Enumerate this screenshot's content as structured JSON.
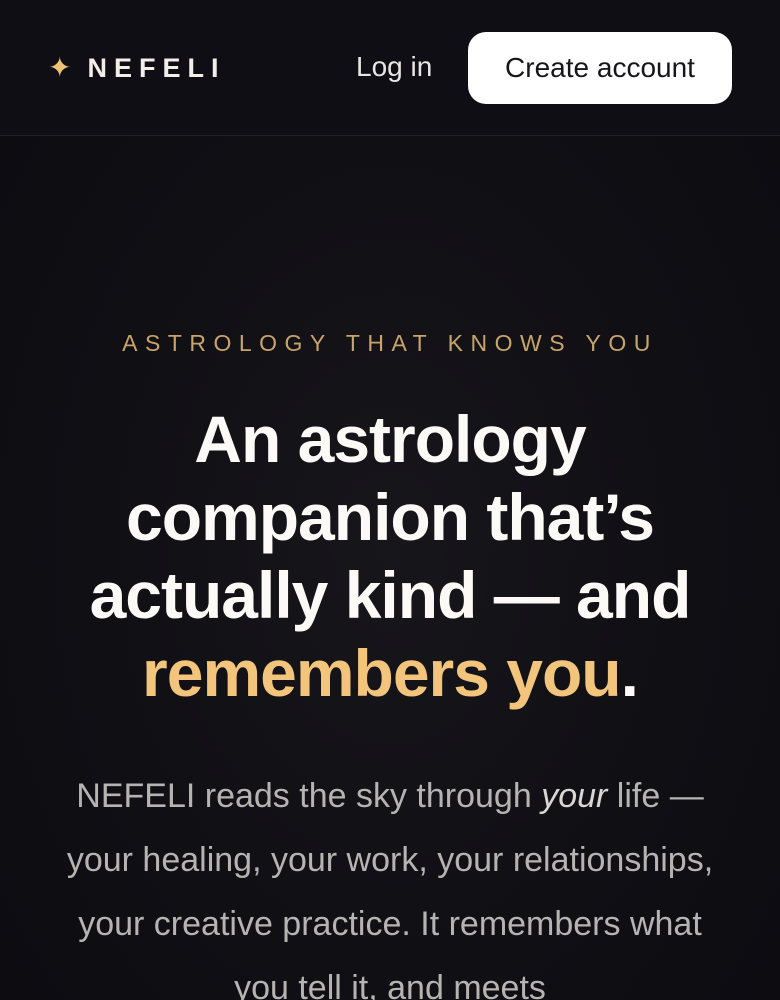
{
  "header": {
    "brand_icon": "four-pointed-star-icon",
    "brand_name": "NEFELI",
    "login_label": "Log in",
    "create_account_label": "Create account"
  },
  "hero": {
    "eyebrow": "ASTROLOGY THAT KNOWS YOU",
    "headline_main": "An astrology companion that’s actually kind — and",
    "headline_accent": "remembers you",
    "headline_end": ".",
    "subtext_part1": "NEFELI reads the sky through",
    "subtext_emphasis": "your",
    "subtext_part2": "life — your healing, your work, your relationships, your creative practice. It remembers what you tell it, and meets"
  },
  "colors": {
    "accent": "#f3c47c",
    "eyebrow": "#c9a46a",
    "background": "#0d0d12",
    "button_bg": "#ffffff"
  }
}
